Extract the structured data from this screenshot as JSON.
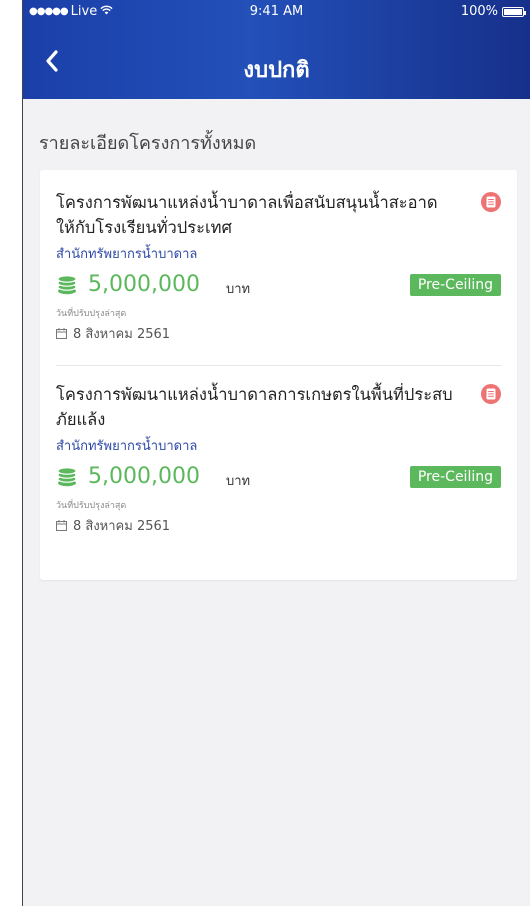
{
  "status_bar": {
    "carrier": "Live",
    "time": "9:41 AM",
    "battery": "100%"
  },
  "nav": {
    "title": "งบปกติ"
  },
  "section_title": "รายละเอียดโครงการทั้งหมด",
  "projects": [
    {
      "title": "โครงการพัฒนาแหล่งน้ำบาดาลเพื่อสนับสนุนน้ำสะอาดให้กับโรงเรียนทั่วประเทศ",
      "agency": "สำนักทรัพยากรน้ำบาดาล",
      "amount": "5,000,000",
      "unit": "บาท",
      "status": "Pre-Ceiling",
      "updated_label": "วันที่ปรับปรุงล่าสุด",
      "updated_date": "8 สิงหาคม 2561"
    },
    {
      "title": "โครงการพัฒนาแหล่งน้ำบาดาลการเกษตรในพื้นที่ประสบภัยแล้ง",
      "agency": "สำนักทรัพยากรน้ำบาดาล",
      "amount": "5,000,000",
      "unit": "บาท",
      "status": "Pre-Ceiling",
      "updated_label": "วันที่ปรับปรุงล่าสุด",
      "updated_date": "8 สิงหาคม 2561"
    }
  ],
  "colors": {
    "header_start": "#1b3fa8",
    "header_end": "#16308a",
    "money_green": "#5cb85c",
    "badge_green": "#5cb85c",
    "agency_blue": "#2f4aa6",
    "doc_icon_red": "#ee7373"
  },
  "icons": {
    "back": "chevron-left-icon",
    "document": "document-icon",
    "coins": "coins-icon",
    "calendar": "calendar-icon",
    "wifi": "wifi-icon",
    "battery": "battery-icon"
  }
}
